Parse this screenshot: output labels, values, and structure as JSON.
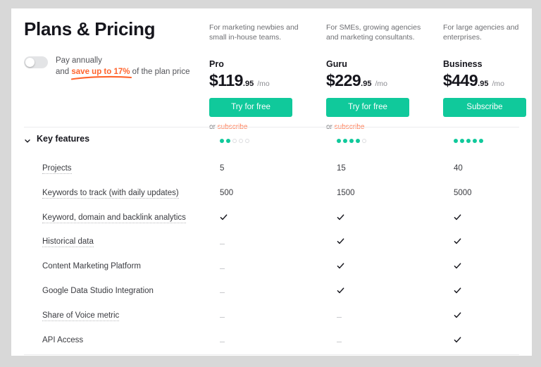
{
  "header": {
    "title": "Plans & Pricing",
    "toggle": {
      "state": "off",
      "label": "Pay annually",
      "sub_prefix": "and ",
      "sub_highlight": "save up to 17%",
      "sub_suffix": " of the plan price",
      "highlight_color": "#ff642d"
    }
  },
  "accent_color": "#10c99b",
  "link_color": "#ff7a52",
  "plans": [
    {
      "description": "For marketing newbies and small in-house teams.",
      "name": "Pro",
      "price_main": "$119",
      "price_cents": ".95",
      "price_period": "/mo",
      "cta_label": "Try for free",
      "sub_prefix": "or ",
      "sub_link": "subscribe",
      "rating_filled": 2,
      "rating_total": 5
    },
    {
      "description": "For SMEs, growing agencies and marketing consultants.",
      "name": "Guru",
      "price_main": "$229",
      "price_cents": ".95",
      "price_period": "/mo",
      "cta_label": "Try for free",
      "sub_prefix": "or ",
      "sub_link": "subscribe",
      "rating_filled": 4,
      "rating_total": 5
    },
    {
      "description": "For large agencies and enterprises.",
      "name": "Business",
      "price_main": "$449",
      "price_cents": ".95",
      "price_period": "/mo",
      "cta_label": "Subscribe",
      "sub_prefix": "",
      "sub_link": "",
      "rating_filled": 5,
      "rating_total": 5
    }
  ],
  "key_features": {
    "section_label": "Key features",
    "expanded": true,
    "rows": [
      {
        "label": "Projects",
        "tooltip": true,
        "pro": "5",
        "guru": "15",
        "business": "40"
      },
      {
        "label": "Keywords to track (with daily updates)",
        "tooltip": true,
        "pro": "500",
        "guru": "1500",
        "business": "5000"
      },
      {
        "label": "Keyword, domain and backlink analytics",
        "tooltip": true,
        "pro": "check",
        "guru": "check",
        "business": "check"
      },
      {
        "label": "Historical data",
        "tooltip": true,
        "pro": "dash",
        "guru": "check",
        "business": "check"
      },
      {
        "label": "Content Marketing Platform",
        "tooltip": false,
        "pro": "dash",
        "guru": "check",
        "business": "check"
      },
      {
        "label": "Google Data Studio Integration",
        "tooltip": false,
        "pro": "dash",
        "guru": "check",
        "business": "check"
      },
      {
        "label": "Share of Voice metric",
        "tooltip": true,
        "pro": "dash",
        "guru": "dash",
        "business": "check"
      },
      {
        "label": "API Access",
        "tooltip": false,
        "pro": "dash",
        "guru": "dash",
        "business": "check"
      }
    ]
  }
}
